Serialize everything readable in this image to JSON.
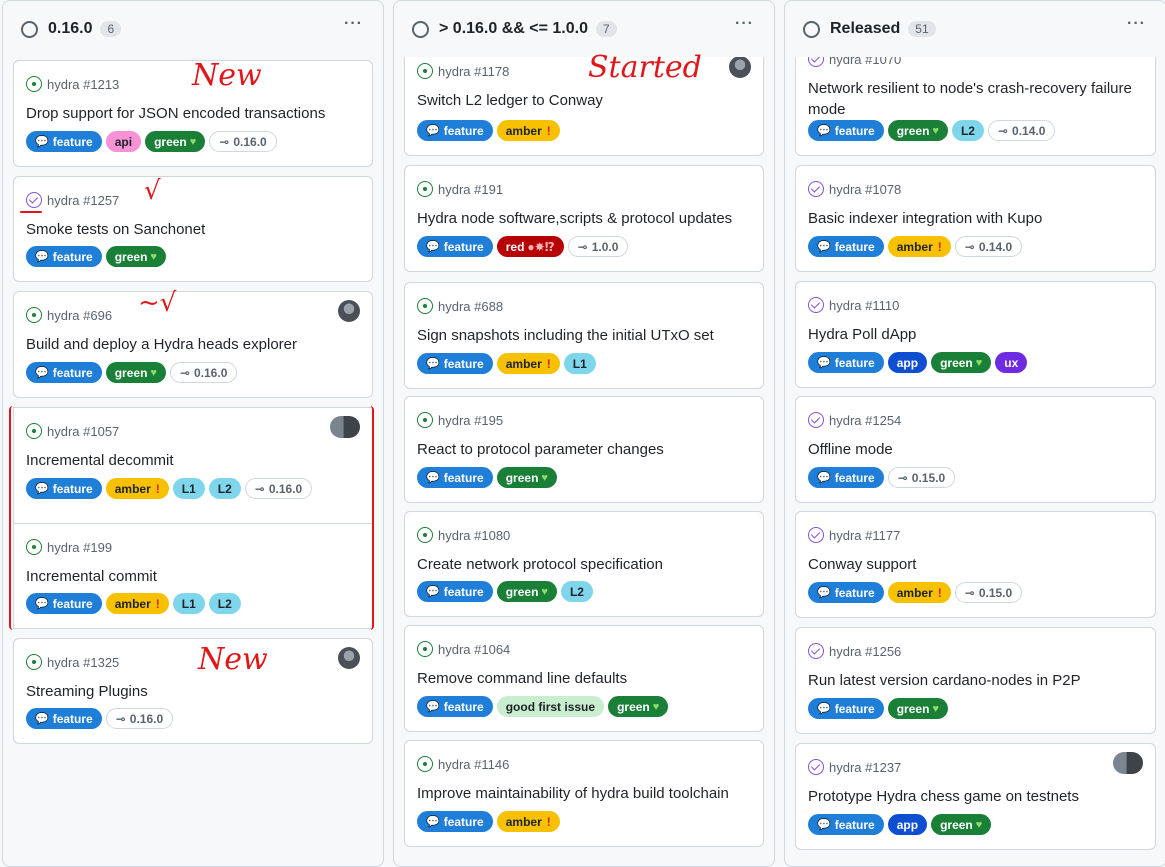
{
  "columns": [
    {
      "title": "0.16.0",
      "count": "6",
      "cards": [
        {
          "ref": "hydra #1213",
          "title": "Drop support for JSON encoded transactions",
          "state": "open",
          "labels": [
            {
              "kind": "feature",
              "text": "feature"
            },
            {
              "kind": "api",
              "text": "api"
            },
            {
              "kind": "green",
              "text": "green"
            },
            {
              "kind": "milestone",
              "text": "0.16.0"
            }
          ]
        },
        {
          "ref": "hydra #1257",
          "title": "Smoke tests on Sanchonet",
          "state": "closed",
          "labels": [
            {
              "kind": "feature",
              "text": "feature"
            },
            {
              "kind": "green",
              "text": "green"
            }
          ]
        },
        {
          "ref": "hydra #696",
          "title": "Build and deploy a Hydra heads explorer",
          "state": "open",
          "labels": [
            {
              "kind": "feature",
              "text": "feature"
            },
            {
              "kind": "green",
              "text": "green"
            },
            {
              "kind": "milestone",
              "text": "0.16.0"
            }
          ]
        },
        {
          "ref": "hydra #1057",
          "title": "Incremental decommit",
          "state": "open",
          "labels": [
            {
              "kind": "feature",
              "text": "feature"
            },
            {
              "kind": "amber",
              "text": "amber"
            },
            {
              "kind": "l1",
              "text": "L1"
            },
            {
              "kind": "l2",
              "text": "L2"
            },
            {
              "kind": "milestone",
              "text": "0.16.0"
            }
          ]
        },
        {
          "ref": "hydra #199",
          "title": "Incremental commit",
          "state": "open",
          "labels": [
            {
              "kind": "feature",
              "text": "feature"
            },
            {
              "kind": "amber",
              "text": "amber"
            },
            {
              "kind": "l1",
              "text": "L1"
            },
            {
              "kind": "l2",
              "text": "L2"
            }
          ]
        },
        {
          "ref": "hydra #1325",
          "title": "Streaming Plugins",
          "state": "open",
          "labels": [
            {
              "kind": "feature",
              "text": "feature"
            },
            {
              "kind": "milestone",
              "text": "0.16.0"
            }
          ]
        }
      ]
    },
    {
      "title": "> 0.16.0 && <= 1.0.0",
      "count": "7",
      "cards": [
        {
          "ref": "hydra #1178",
          "title": "Switch L2 ledger to Conway",
          "state": "open",
          "labels": [
            {
              "kind": "feature",
              "text": "feature"
            },
            {
              "kind": "amber",
              "text": "amber"
            }
          ]
        },
        {
          "ref": "hydra #191",
          "title": "Hydra node software,scripts & protocol updates",
          "state": "open",
          "labels": [
            {
              "kind": "feature",
              "text": "feature"
            },
            {
              "kind": "red",
              "text": "red"
            },
            {
              "kind": "milestone",
              "text": "1.0.0"
            }
          ]
        },
        {
          "ref": "hydra #688",
          "title": "Sign snapshots including the initial UTxO set",
          "state": "open",
          "labels": [
            {
              "kind": "feature",
              "text": "feature"
            },
            {
              "kind": "amber",
              "text": "amber"
            },
            {
              "kind": "l1",
              "text": "L1"
            }
          ]
        },
        {
          "ref": "hydra #195",
          "title": "React to protocol parameter changes",
          "state": "open",
          "labels": [
            {
              "kind": "feature",
              "text": "feature"
            },
            {
              "kind": "green",
              "text": "green"
            }
          ]
        },
        {
          "ref": "hydra #1080",
          "title": "Create network protocol specification",
          "state": "open",
          "labels": [
            {
              "kind": "feature",
              "text": "feature"
            },
            {
              "kind": "green",
              "text": "green"
            },
            {
              "kind": "l2",
              "text": "L2"
            }
          ]
        },
        {
          "ref": "hydra #1064",
          "title": "Remove command line defaults",
          "state": "open",
          "labels": [
            {
              "kind": "feature",
              "text": "feature"
            },
            {
              "kind": "gfi",
              "text": "good first issue"
            },
            {
              "kind": "green",
              "text": "green"
            }
          ]
        },
        {
          "ref": "hydra #1146",
          "title": "Improve maintainability of hydra build toolchain",
          "state": "open",
          "labels": [
            {
              "kind": "feature",
              "text": "feature"
            },
            {
              "kind": "amber",
              "text": "amber"
            }
          ]
        }
      ]
    },
    {
      "title": "Released",
      "count": "51",
      "cards": [
        {
          "ref": "hydra #1070",
          "title": "Network resilient to node's crash-recovery failure mode",
          "state": "closed",
          "labels": [
            {
              "kind": "feature",
              "text": "feature"
            },
            {
              "kind": "green",
              "text": "green"
            },
            {
              "kind": "l2",
              "text": "L2"
            },
            {
              "kind": "milestone",
              "text": "0.14.0"
            }
          ]
        },
        {
          "ref": "hydra #1078",
          "title": "Basic indexer integration with Kupo",
          "state": "closed",
          "labels": [
            {
              "kind": "feature",
              "text": "feature"
            },
            {
              "kind": "amber",
              "text": "amber"
            },
            {
              "kind": "milestone",
              "text": "0.14.0"
            }
          ]
        },
        {
          "ref": "hydra #1110",
          "title": "Hydra Poll dApp",
          "state": "closed",
          "labels": [
            {
              "kind": "feature",
              "text": "feature"
            },
            {
              "kind": "app",
              "text": "app"
            },
            {
              "kind": "green",
              "text": "green"
            },
            {
              "kind": "ux",
              "text": "ux"
            }
          ]
        },
        {
          "ref": "hydra #1254",
          "title": "Offline mode",
          "state": "closed",
          "labels": [
            {
              "kind": "feature",
              "text": "feature"
            },
            {
              "kind": "milestone",
              "text": "0.15.0"
            }
          ]
        },
        {
          "ref": "hydra #1177",
          "title": "Conway support",
          "state": "closed",
          "labels": [
            {
              "kind": "feature",
              "text": "feature"
            },
            {
              "kind": "amber",
              "text": "amber"
            },
            {
              "kind": "milestone",
              "text": "0.15.0"
            }
          ]
        },
        {
          "ref": "hydra #1256",
          "title": "Run latest version cardano-nodes in P2P",
          "state": "closed",
          "labels": [
            {
              "kind": "feature",
              "text": "feature"
            },
            {
              "kind": "green",
              "text": "green"
            }
          ]
        },
        {
          "ref": "hydra #1237",
          "title": "Prototype Hydra chess game on testnets",
          "state": "closed",
          "labels": [
            {
              "kind": "feature",
              "text": "feature"
            },
            {
              "kind": "app",
              "text": "app"
            },
            {
              "kind": "green",
              "text": "green"
            }
          ]
        }
      ]
    }
  ],
  "annotations": {
    "new_1": "New",
    "started": "Started",
    "check": "√",
    "check_2": "~√",
    "new_2": "New"
  },
  "colors": {
    "feature": "#1f7ed8",
    "green": "#1a7f37",
    "amber": "#f7c100",
    "red": "#b60205",
    "api": "#f692d5",
    "l": "#7fd6ec",
    "app": "#0e4ed1",
    "ux": "#6f2be0",
    "annotation": "#e0171a"
  }
}
